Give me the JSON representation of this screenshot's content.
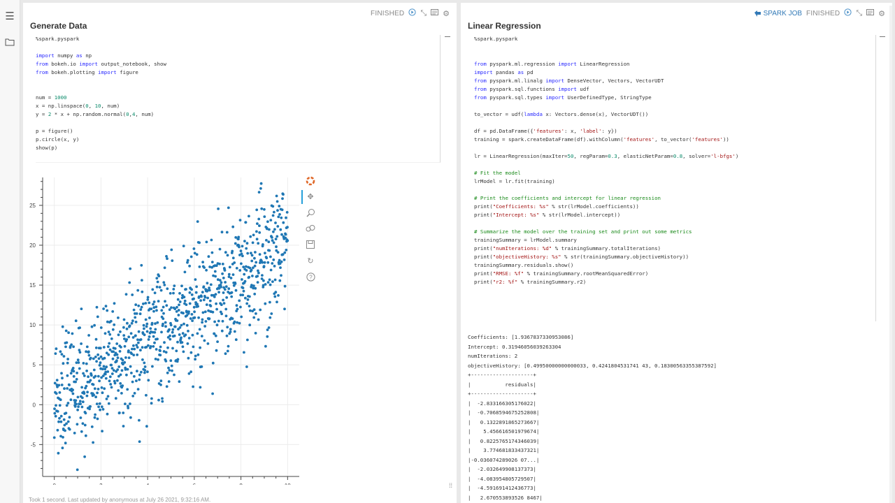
{
  "left_panel": {
    "menu_icon": "hamburger-menu-icon",
    "folder_icon": "folder-icon"
  },
  "para1": {
    "status": "FINISHED",
    "title": "Generate Data",
    "code": [
      "%spark.pyspark",
      "",
      "import numpy as np",
      "from bokeh.io import output_notebook, show",
      "from bokeh.plotting import figure",
      "",
      "",
      "num = 1000",
      "x = np.linspace(0, 10, num)",
      "y = 2 * x + np.random.normal(0,4, num)",
      "",
      "p = figure()",
      "p.circle(x, y)",
      "show(p)"
    ],
    "footer": "Took 1 second. Last updated by anonymous at July 26 2021, 9:32:16 AM.",
    "toolbar_icons": [
      "bokeh-logo-icon",
      "pan-icon",
      "box-zoom-icon",
      "wheel-zoom-icon",
      "save-icon",
      "reset-icon",
      "help-icon"
    ]
  },
  "para2": {
    "spark_job_label": "SPARK JOB",
    "status": "FINISHED",
    "title": "Linear Regression",
    "code": [
      "%spark.pyspark",
      "",
      "",
      "from pyspark.ml.regression import LinearRegression",
      "import pandas as pd",
      "from pyspark.ml.linalg import DenseVector, Vectors, VectorUDT",
      "from pyspark.sql.functions import udf",
      "from pyspark.sql.types import UserDefinedType, StringType",
      "",
      "to_vector = udf(lambda x: Vectors.dense(x), VectorUDT())",
      "",
      "df = pd.DataFrame({'features': x, 'label': y})",
      "training = spark.createDataFrame(df).withColumn('features', to_vector('features'))",
      "",
      "lr = LinearRegression(maxIter=50, regParam=0.3, elasticNetParam=0.8, solver='l-bfgs')",
      "",
      "# Fit the model",
      "lrModel = lr.fit(training)",
      "",
      "# Print the coefficients and intercept for linear regression",
      "print(\"Coefficients: %s\" % str(lrModel.coefficients))",
      "print(\"Intercept: %s\" % str(lrModel.intercept))",
      "",
      "# Summarize the model over the training set and print out some metrics",
      "trainingSummary = lrModel.summary",
      "print(\"numIterations: %d\" % trainingSummary.totalIterations)",
      "print(\"objectiveHistory: %s\" % str(trainingSummary.objectiveHistory))",
      "trainingSummary.residuals.show()",
      "print(\"RMSE: %f\" % trainingSummary.rootMeanSquaredError)",
      "print(\"r2: %f\" % trainingSummary.r2)"
    ],
    "output": [
      "Coefficients: [1.9367837330953086]",
      "Intercept: 0.31946056039263304",
      "numIterations: 2",
      "objectiveHistory: [0.49950000000000033, 0.4241804531741 43, 0.18300563355387592]",
      "+--------------------+",
      "|           residuals|",
      "+--------------------+",
      "|  -2.833166305176022|",
      "|  -0.7068594675252808|",
      "|   0.1322891865273667|",
      "|    5.456616501979674|",
      "|   0.8225765174346039|",
      "|    3.774681833437321|",
      "|-0.036074289026 07...|",
      "|  -2.032649908137373|",
      "|  -4.083954805729507|",
      "|  -4.591691412436773|",
      "|   2.670553893526 8467|"
    ]
  },
  "chart_data": {
    "type": "scatter",
    "title": "",
    "xlabel": "",
    "ylabel": "",
    "xlim": [
      -0.5,
      10.5
    ],
    "ylim": [
      -9,
      28.5
    ],
    "xticks": [
      0,
      2,
      4,
      6,
      8,
      10
    ],
    "yticks": [
      -5,
      0,
      5,
      10,
      15,
      20,
      25
    ],
    "grid": true,
    "marker_color": "#1f77b4",
    "generator": {
      "n": 1000,
      "slope": 2,
      "intercept": 0,
      "noise_sd": 4,
      "x_range": [
        0,
        10
      ]
    }
  }
}
